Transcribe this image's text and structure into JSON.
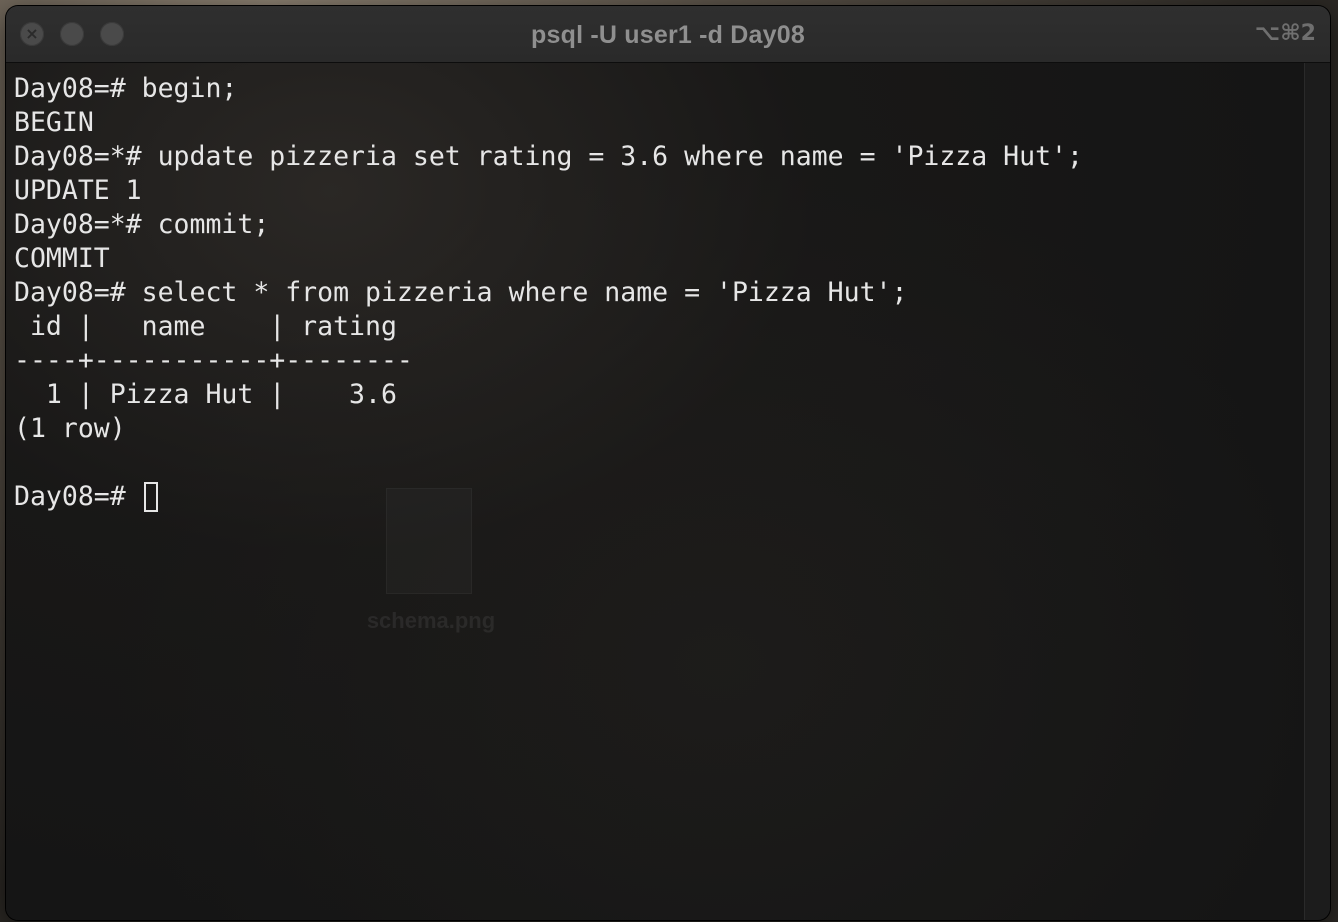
{
  "window": {
    "title": "psql -U user1 -d Day08",
    "shortcut": "⌥⌘2",
    "close_glyph": "×"
  },
  "desktop": {
    "file_label": "schema.png"
  },
  "terminal": {
    "lines": [
      "Day08=# begin;",
      "BEGIN",
      "Day08=*# update pizzeria set rating = 3.6 where name = 'Pizza Hut';",
      "UPDATE 1",
      "Day08=*# commit;",
      "COMMIT",
      "Day08=# select * from pizzeria where name = 'Pizza Hut';",
      " id |   name    | rating",
      "----+-----------+--------",
      "  1 | Pizza Hut |    3.6",
      "(1 row)",
      ""
    ],
    "prompt": "Day08=# "
  },
  "colors": {
    "terminal_bg": "#151515",
    "text": "#e6e6e6",
    "titlebar": "#2c2c2c"
  }
}
